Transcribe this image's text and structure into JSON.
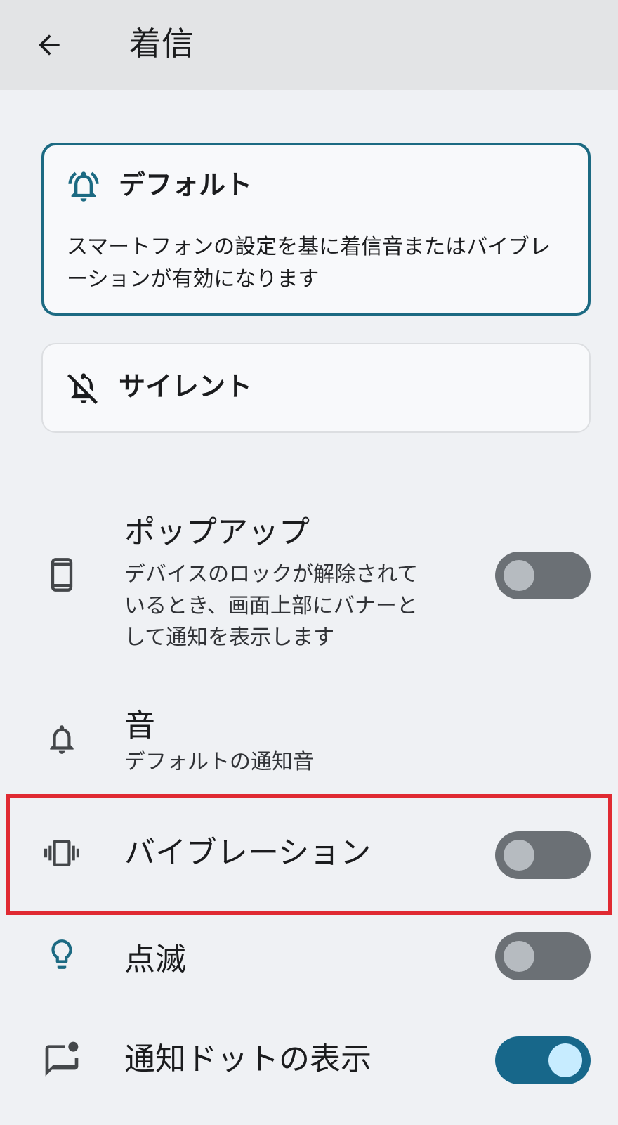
{
  "appbar": {
    "title": "着信",
    "back_icon": "arrow-back-icon"
  },
  "modes": {
    "default": {
      "title": "デフォルト",
      "description": "スマートフォンの設定を基に着信音またはバイブレーションが有効になります",
      "icon": "bell-ring-icon",
      "selected": true
    },
    "silent": {
      "title": "サイレント",
      "icon": "bell-off-icon",
      "selected": false
    }
  },
  "settings": {
    "popup": {
      "title": "ポップアップ",
      "subtitle_lines": [
        "デバイスのロックが解除されて",
        "いるとき、画面上部にバナーと",
        "して通知を表示します"
      ],
      "icon": "phone-icon",
      "enabled": false
    },
    "sound": {
      "title": "音",
      "subtitle": "デフォルトの通知音",
      "icon": "bell-icon"
    },
    "vibration": {
      "title": "バイブレーション",
      "icon": "vibration-icon",
      "enabled": false
    },
    "blink": {
      "title": "点滅",
      "icon": "lightbulb-icon",
      "enabled": false
    },
    "notification_dot": {
      "title": "通知ドットの表示",
      "icon": "chat-dot-icon",
      "enabled": true
    }
  },
  "colors": {
    "accent": "#1c6a82",
    "toggle_on": "#17678a",
    "toggle_off": "#6b7075",
    "highlight": "#e02a32"
  }
}
